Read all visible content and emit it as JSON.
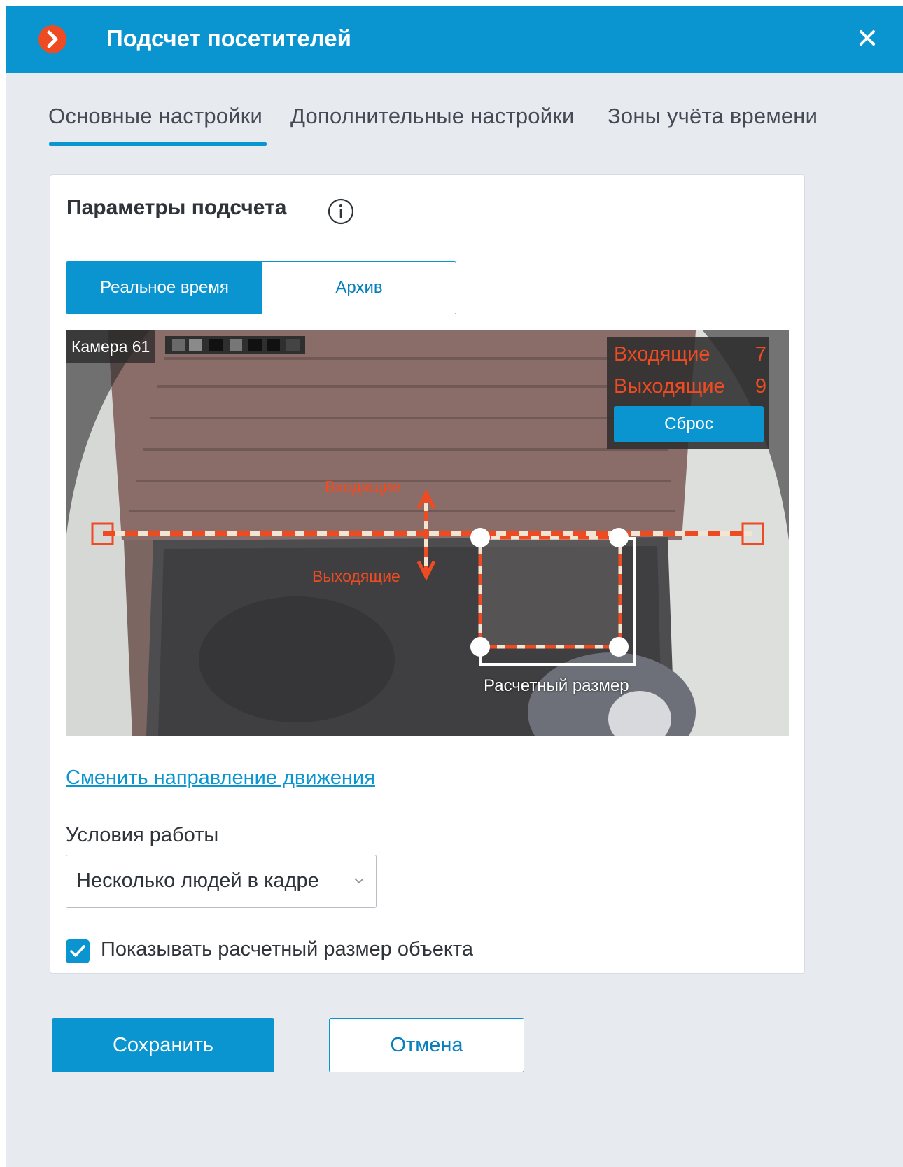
{
  "window": {
    "title": "Подсчет посетителей",
    "accent_color": "#0a95d1",
    "logo_color": "#ee4b22"
  },
  "tabs": [
    {
      "label": "Основные настройки",
      "active": true
    },
    {
      "label": "Дополнительные настройки",
      "active": false
    },
    {
      "label": "Зоны учёта времени",
      "active": false
    }
  ],
  "panel": {
    "title": "Параметры подсчета",
    "mode_switch": {
      "realtime": "Реальное время",
      "archive": "Архив",
      "selected": "Реальное время"
    },
    "video": {
      "camera_label": "Камера 61",
      "counter": {
        "incoming_label": "Входящие",
        "incoming_value": "7",
        "outgoing_label": "Выходящие",
        "outgoing_value": "9",
        "reset_label": "Сброс"
      },
      "line_labels": {
        "incoming": "Входящие",
        "outgoing": "Выходящие"
      },
      "size_label": "Расчетный размер"
    },
    "change_direction_link": "Сменить направление движения",
    "work_conditions": {
      "label": "Условия работы",
      "value": "Несколько людей в кадре"
    },
    "show_size_checkbox": {
      "label": "Показывать расчетный размер объекта",
      "checked": true
    }
  },
  "footer": {
    "save_label": "Сохранить",
    "cancel_label": "Отмена"
  }
}
